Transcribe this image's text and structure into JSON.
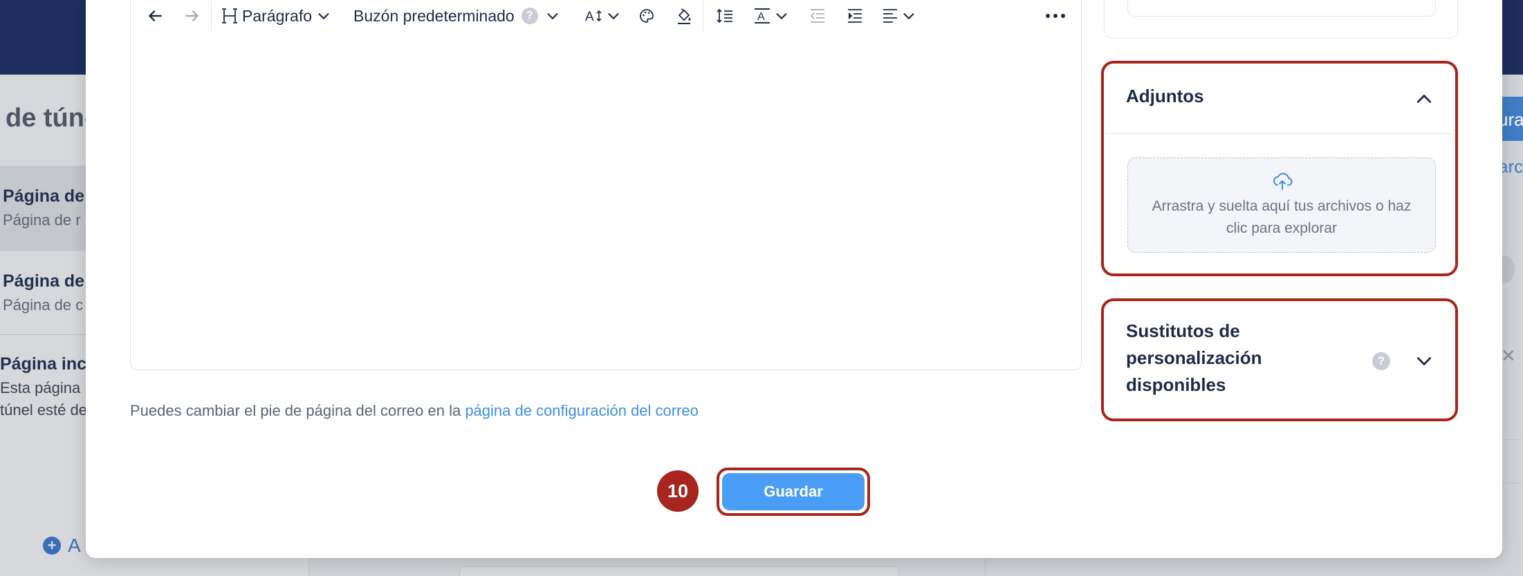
{
  "background": {
    "page_title": "de túne",
    "items": [
      {
        "title": "Página de",
        "subtitle": "Página de r"
      },
      {
        "title": "Página de",
        "subtitle": "Página de c"
      },
      {
        "title": "Página inc",
        "subtitle": "Esta página",
        "subtitle2": "túnel esté de"
      }
    ],
    "add_label": "A",
    "right_button": "ura",
    "right_link": "arc"
  },
  "toolbar": {
    "paragraph_label": "Parágrafo",
    "mailbox_label": "Buzón predeterminado",
    "help_label": "?"
  },
  "footer": {
    "note_text": "Puedes cambiar el pie de página del correo en la ",
    "note_link": "página de configuración del correo"
  },
  "save": {
    "step_number": "10",
    "label": "Guardar"
  },
  "attachments": {
    "title": "Adjuntos",
    "dropzone_text": "Arrastra y suelta aquí tus archivos o haz clic para explorar"
  },
  "substitutes": {
    "title": "Sustitutos de personalización disponibles",
    "help_label": "?"
  },
  "colors": {
    "accent": "#4a9df4",
    "highlight": "#a7251c",
    "link": "#3d8ee6",
    "text_dark": "#1c2b4a"
  }
}
